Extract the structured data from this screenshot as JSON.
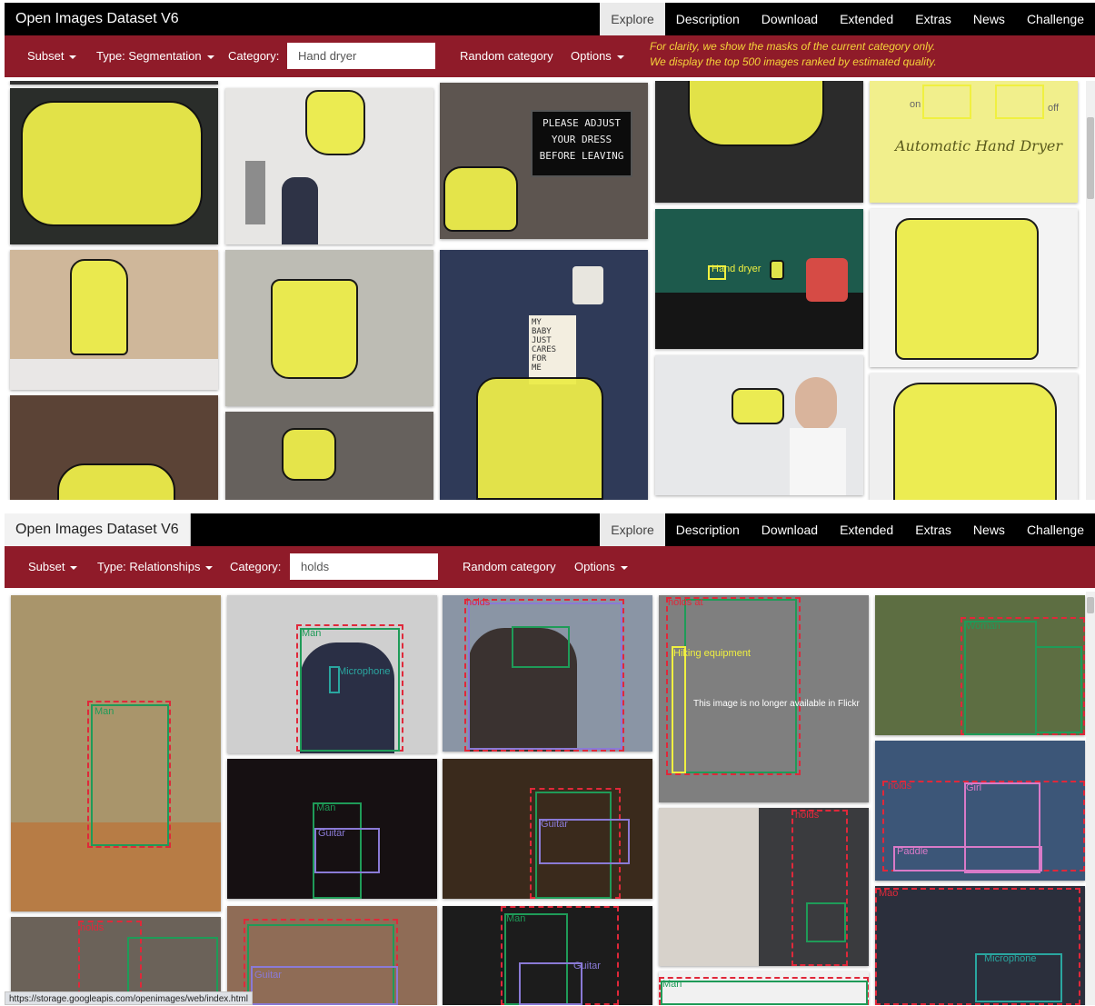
{
  "panel_seg": {
    "brand": "Open Images Dataset V6",
    "tabs": [
      "Explore",
      "Description",
      "Download",
      "Extended",
      "Extras",
      "News",
      "Challenge"
    ],
    "subset": "Subset",
    "type": "Type: Segmentation",
    "category_label": "Category:",
    "category_value": "Hand dryer",
    "random": "Random category",
    "options": "Options",
    "notice_line1": "For clarity, we show the masks of the current category only.",
    "notice_line2": "We display the top 500 images ranked by estimated quality.",
    "sign_lines": [
      "PLEASE ADJUST",
      "YOUR DRESS",
      "BEFORE LEAVING"
    ],
    "note_lines": [
      "MY",
      "BABY",
      "JUST",
      "CARES",
      "FOR",
      "ME"
    ],
    "dryer_text": "Automatic Hand Dryer",
    "on_label": "on",
    "off_label": "off",
    "box_label": "Hand dryer"
  },
  "panel_rel": {
    "brand": "Open Images Dataset V6",
    "tabs": [
      "Explore",
      "Description",
      "Download",
      "Extended",
      "Extras",
      "News",
      "Challenge"
    ],
    "subset": "Subset",
    "type": "Type: Relationships",
    "category_label": "Category:",
    "category_value": "holds",
    "random": "Random category",
    "options": "Options",
    "unavailable": "This image is no longer available in Flickr",
    "labels": {
      "man": "Man",
      "holds": "holds",
      "holds_at": "holds  at",
      "microphone": "Microphone",
      "guitar": "Guitar",
      "hiking": "Hiking equipment",
      "girl": "Girl",
      "paddle": "Paddle",
      "woman": "Woman",
      "mao": "Mao"
    }
  },
  "status_url": "https://storage.googleapis.com/openimages/web/index.html",
  "colors": {
    "topbar": "#000000",
    "toolbar": "#8f1b29",
    "notice": "#f5d33a",
    "mask": "#ecec4a",
    "box_red": "#e0283a",
    "box_green": "#1f9b58",
    "box_purple": "#8a7ad6",
    "box_teal": "#2aa6a0",
    "box_yellow": "#f0f040"
  }
}
